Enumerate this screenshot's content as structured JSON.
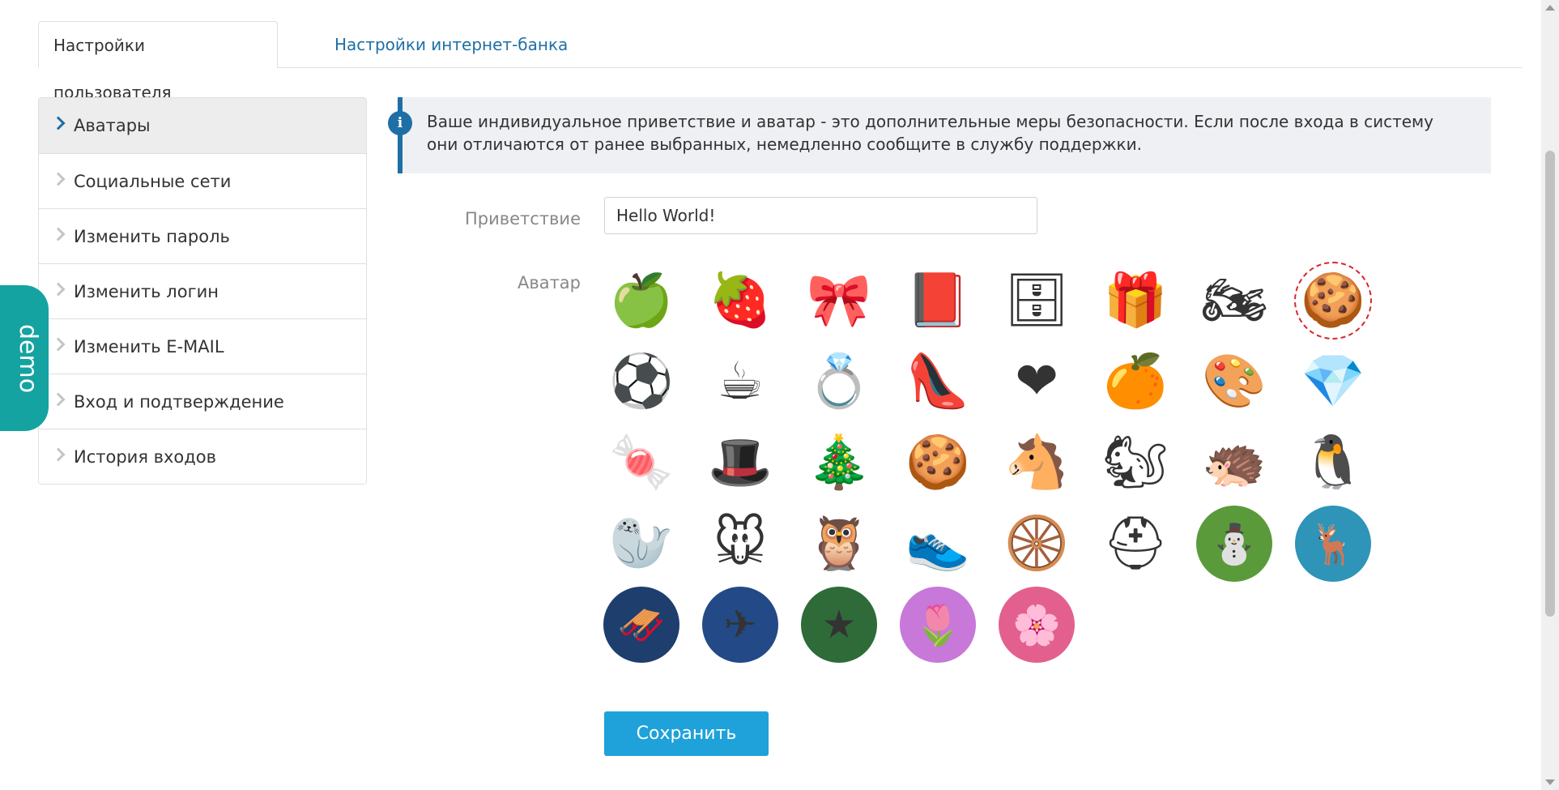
{
  "tabs": [
    {
      "label": "Настройки пользователя",
      "active": true
    },
    {
      "label": "Настройки интернет-банка",
      "active": false
    }
  ],
  "sidebar": {
    "items": [
      {
        "label": "Аватары",
        "active": true
      },
      {
        "label": "Социальные сети",
        "active": false
      },
      {
        "label": "Изменить пароль",
        "active": false
      },
      {
        "label": "Изменить логин",
        "active": false
      },
      {
        "label": "Изменить E-MAIL",
        "active": false
      },
      {
        "label": "Вход и подтверждение",
        "active": false
      },
      {
        "label": "История входов",
        "active": false
      }
    ]
  },
  "demo_badge": "demo",
  "info": {
    "icon": "info-icon",
    "text": "Ваше индивидуальное приветствие и аватар - это дополнительные меры безопасности. Если после входа в систему они отличаются от ранее выбранных, немедленно сообщите в службу поддержки."
  },
  "form": {
    "greeting_label": "Приветствие",
    "greeting_value": "Hello World!",
    "avatar_label": "Аватар",
    "save_label": "Сохранить"
  },
  "avatars": [
    {
      "name": "apple",
      "glyph": "🍏",
      "selected": false
    },
    {
      "name": "raspberry",
      "glyph": "🍓",
      "selected": false
    },
    {
      "name": "bow-tie",
      "glyph": "🎀",
      "selected": false
    },
    {
      "name": "book",
      "glyph": "📕",
      "selected": false
    },
    {
      "name": "safe",
      "glyph": "🗄",
      "selected": false
    },
    {
      "name": "gift",
      "glyph": "🎁",
      "selected": false
    },
    {
      "name": "motorcycle",
      "glyph": "🏍",
      "selected": false
    },
    {
      "name": "cookie-snowflake",
      "glyph": "🍪",
      "selected": true
    },
    {
      "name": "soccer-ball",
      "glyph": "⚽",
      "selected": false
    },
    {
      "name": "cup",
      "glyph": "☕",
      "selected": false
    },
    {
      "name": "ring",
      "glyph": "💍",
      "selected": false
    },
    {
      "name": "high-heels",
      "glyph": "👠",
      "selected": false
    },
    {
      "name": "heart-cookie",
      "glyph": "❤",
      "selected": false
    },
    {
      "name": "orange",
      "glyph": "🍊",
      "selected": false
    },
    {
      "name": "palette",
      "glyph": "🎨",
      "selected": false
    },
    {
      "name": "gem",
      "glyph": "💎",
      "selected": false
    },
    {
      "name": "candy-cane",
      "glyph": "🍬",
      "selected": false
    },
    {
      "name": "top-hat",
      "glyph": "🎩",
      "selected": false
    },
    {
      "name": "christmas-tree-cookie",
      "glyph": "🎄",
      "selected": false
    },
    {
      "name": "gingerbread-man",
      "glyph": "🍪",
      "selected": false
    },
    {
      "name": "donkey",
      "glyph": "🐴",
      "selected": false
    },
    {
      "name": "squirrel",
      "glyph": "🐿",
      "selected": false
    },
    {
      "name": "hedgehog",
      "glyph": "🦔",
      "selected": false
    },
    {
      "name": "penguin",
      "glyph": "🐧",
      "selected": false
    },
    {
      "name": "walrus",
      "glyph": "🦭",
      "selected": false
    },
    {
      "name": "mouse",
      "glyph": "🐭",
      "selected": false
    },
    {
      "name": "owl",
      "glyph": "🦉",
      "selected": false
    },
    {
      "name": "sneaker",
      "glyph": "👟",
      "selected": false
    },
    {
      "name": "steering-wheel",
      "glyph": "🛞",
      "selected": false
    },
    {
      "name": "helmet",
      "glyph": "⛑",
      "selected": false
    },
    {
      "name": "snowman",
      "glyph": "⛄",
      "selected": false,
      "disc": "#5a9a3a"
    },
    {
      "name": "deer",
      "glyph": "🦌",
      "selected": false,
      "disc": "#2e94b8"
    },
    {
      "name": "santa-sleigh",
      "glyph": "🛷",
      "selected": false,
      "disc": "#1e3e6e"
    },
    {
      "name": "planes",
      "glyph": "✈",
      "selected": false,
      "disc": "#234a86"
    },
    {
      "name": "red-star",
      "glyph": "★",
      "selected": false,
      "disc": "#2e6b38"
    },
    {
      "name": "tulips",
      "glyph": "🌷",
      "selected": false,
      "disc": "#c778d8"
    },
    {
      "name": "blossom",
      "glyph": "🌸",
      "selected": false,
      "disc": "#e3608e"
    }
  ]
}
